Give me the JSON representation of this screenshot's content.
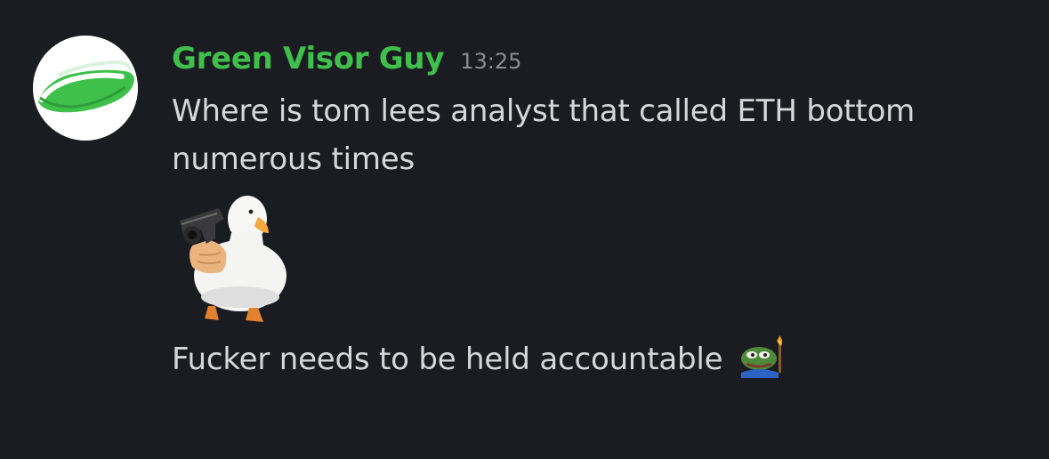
{
  "message": {
    "author": "Green Visor Guy",
    "timestamp": "13:25",
    "text_line_1": "Where is tom lees analyst that called ETH bottom numerous times",
    "text_line_2": "Fucker needs to be held accountable",
    "avatar_icon": "green-visor-icon",
    "sticker_icon": "duck-with-gun-sticker",
    "emoji_icon": "pepe-torch-emoji"
  },
  "colors": {
    "background": "#1b1c21",
    "author": "#3fbf4b",
    "text": "#d6d7da",
    "timestamp": "#8b8d94"
  }
}
